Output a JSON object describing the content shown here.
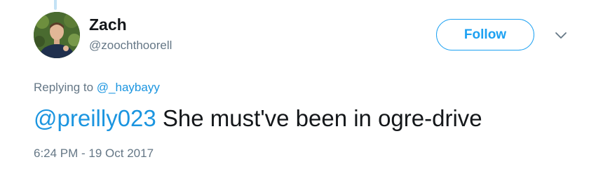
{
  "tweet": {
    "author": {
      "display_name": "Zach",
      "handle": "@zoochthoorell",
      "avatar": "profile-photo"
    },
    "follow_label": "Follow",
    "menu_icon": "chevron-down-icon",
    "reply_prefix": "Replying to",
    "reply_to": "@_haybayy",
    "mention": "@preilly023",
    "body": "She must've been in ogre-drive",
    "timestamp": "6:24 PM - 19 Oct 2017"
  },
  "colors": {
    "accent": "#1da1f2",
    "link": "#1b95e0",
    "secondary_text": "#657786",
    "primary_text": "#14171a",
    "thread_line": "#c4e2f5"
  }
}
